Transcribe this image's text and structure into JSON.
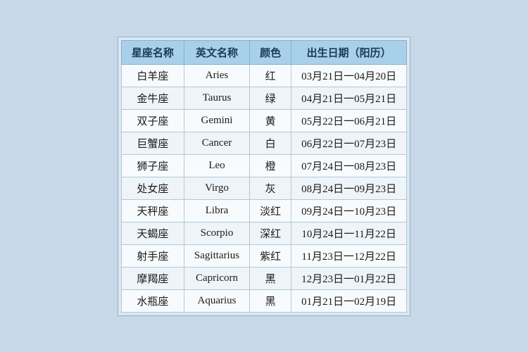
{
  "table": {
    "headers": [
      "星座名称",
      "英文名称",
      "颜色",
      "出生日期（阳历）"
    ],
    "rows": [
      {
        "chinese": "白羊座",
        "english": "Aries",
        "color": "红",
        "dates": "03月21日一04月20日"
      },
      {
        "chinese": "金牛座",
        "english": "Taurus",
        "color": "绿",
        "dates": "04月21日一05月21日"
      },
      {
        "chinese": "双子座",
        "english": "Gemini",
        "color": "黄",
        "dates": "05月22日一06月21日"
      },
      {
        "chinese": "巨蟹座",
        "english": "Cancer",
        "color": "白",
        "dates": "06月22日一07月23日"
      },
      {
        "chinese": "狮子座",
        "english": "Leo",
        "color": "橙",
        "dates": "07月24日一08月23日"
      },
      {
        "chinese": "处女座",
        "english": "Virgo",
        "color": "灰",
        "dates": "08月24日一09月23日"
      },
      {
        "chinese": "天秤座",
        "english": "Libra",
        "color": "淡红",
        "dates": "09月24日一10月23日"
      },
      {
        "chinese": "天蝎座",
        "english": "Scorpio",
        "color": "深红",
        "dates": "10月24日一11月22日"
      },
      {
        "chinese": "射手座",
        "english": "Sagittarius",
        "color": "紫红",
        "dates": "11月23日一12月22日"
      },
      {
        "chinese": "摩羯座",
        "english": "Capricorn",
        "color": "黑",
        "dates": "12月23日一01月22日"
      },
      {
        "chinese": "水瓶座",
        "english": "Aquarius",
        "color": "黑",
        "dates": "01月21日一02月19日"
      }
    ]
  }
}
